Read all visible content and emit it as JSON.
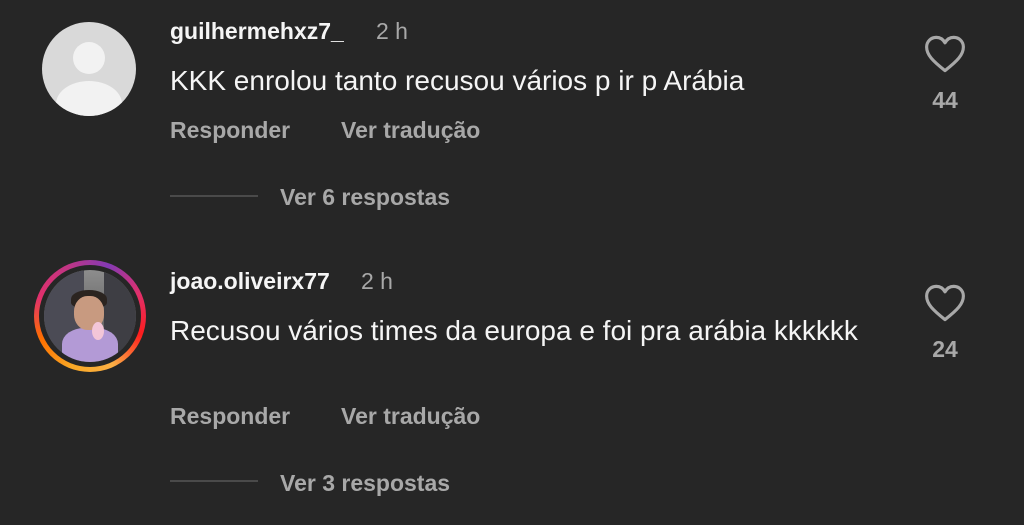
{
  "comments": [
    {
      "username": "guilhermehxz7_",
      "time": "2 h",
      "text": "KKK enrolou tanto recusou vários p ir p Arábia",
      "reply_label": "Responder",
      "translate_label": "Ver tradução",
      "view_replies": "Ver 6 respostas",
      "likes": "44",
      "avatar": "default-avatar"
    },
    {
      "username": "joao.oliveirx77",
      "time": "2 h",
      "text": "Recusou vários times da europa e foi pra arábia kkkkkk",
      "reply_label": "Responder",
      "translate_label": "Ver tradução",
      "view_replies": "Ver 3 respostas",
      "likes": "24",
      "avatar": "story-ring-avatar"
    }
  ],
  "colors": {
    "background": "#262626",
    "primary_text": "#f5f5f5",
    "secondary_text": "#a8a8a8"
  },
  "icons": [
    "heart-icon"
  ]
}
